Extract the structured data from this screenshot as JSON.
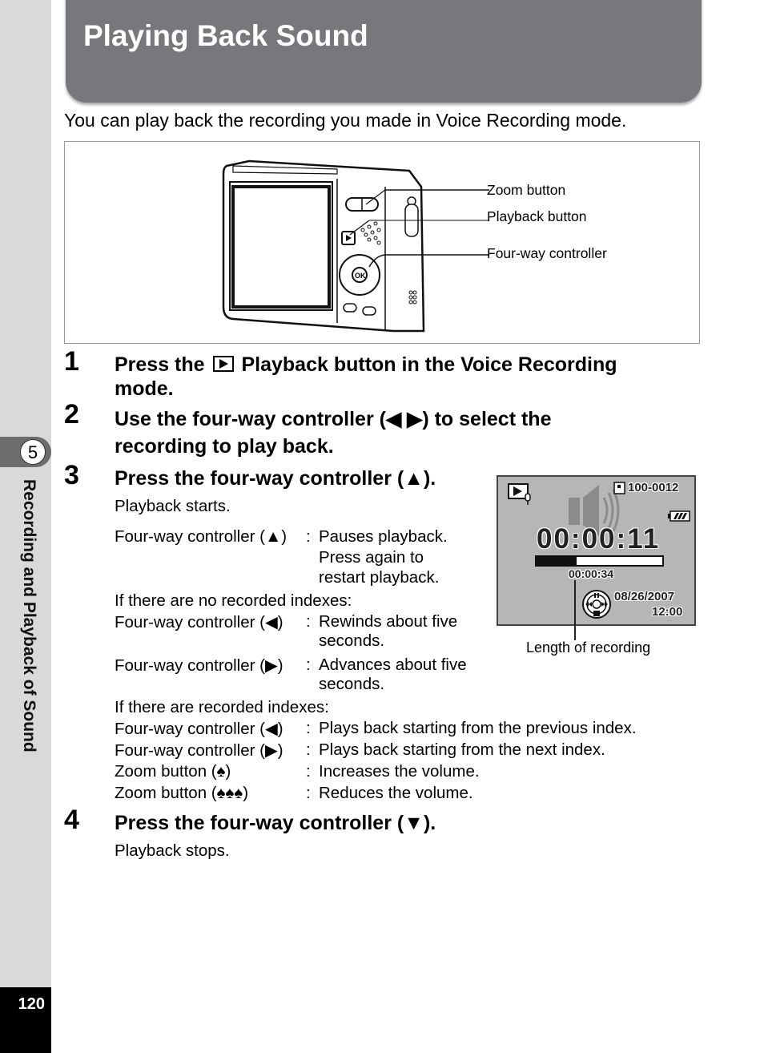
{
  "page": {
    "title": "Playing Back Sound",
    "intro": "You can play back the recording you made in Voice Recording mode.",
    "page_number": "120",
    "chapter_number": "5",
    "chapter_title": "Recording and Playback of Sound"
  },
  "figure": {
    "callouts": [
      "Zoom button",
      "Playback button",
      "Four-way controller"
    ],
    "ok_label": "OK"
  },
  "steps": [
    {
      "num": "1",
      "text_before_icon": "Press the",
      "icon": "playback-icon",
      "text_after_icon": "Playback button in the Voice Recording",
      "text_line2": "mode."
    },
    {
      "num": "2",
      "line1": "Use the four-way controller (◀ ▶) to select the",
      "line2": "recording to play back."
    },
    {
      "num": "3",
      "heading": "Press the four-way controller (▲).",
      "result": "Playback starts."
    },
    {
      "num": "4",
      "heading": "Press the four-way controller (▼).",
      "result": "Playback stops."
    }
  ],
  "controls": {
    "up": {
      "key": "Four-way controller (▲)",
      "lines": [
        "Pauses playback.",
        "Press again to",
        "restart playback."
      ]
    },
    "no_index_heading": "If there are no recorded indexes:",
    "no_index": [
      {
        "key": "Four-way controller (◀)",
        "lines": [
          "Rewinds about five",
          "seconds."
        ]
      },
      {
        "key": "Four-way controller (▶)",
        "lines": [
          "Advances about five",
          "seconds."
        ]
      }
    ],
    "index_heading": "If there are recorded indexes:",
    "index": [
      {
        "key": "Four-way controller (◀)",
        "value": "Plays back starting from the previous index."
      },
      {
        "key": "Four-way controller (▶)",
        "value": "Plays back starting from the next index."
      },
      {
        "key": "Zoom button (♠)",
        "value": "Increases the volume."
      },
      {
        "key": "Zoom button (♠♠♠)",
        "value": "Reduces the volume."
      }
    ],
    "colon": ":"
  },
  "lcd": {
    "file_number": "100-0012",
    "elapsed": "00:00:11",
    "total": "00:00:34",
    "progress_fraction": 0.32,
    "date": "08/26/2007",
    "time": "12:00",
    "caption": "Length of recording"
  }
}
